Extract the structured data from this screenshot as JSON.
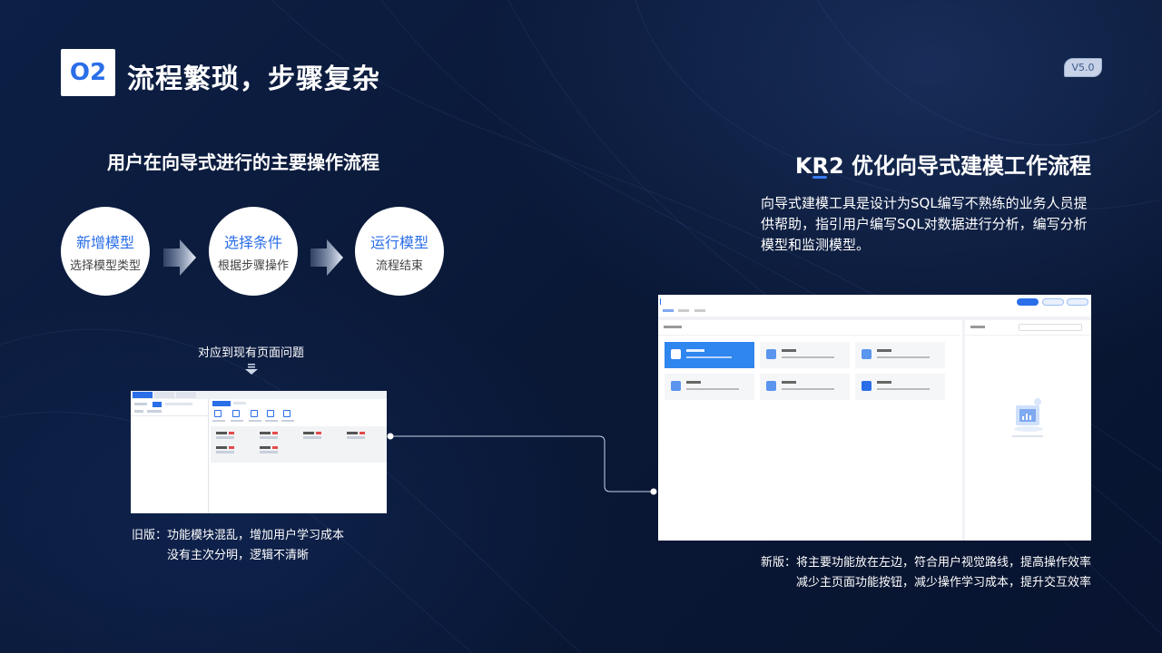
{
  "header": {
    "section_number": "O2",
    "title": "流程繁琐，步骤复杂",
    "version": "V5.0"
  },
  "left": {
    "heading": "用户在向导式进行的主要操作流程",
    "steps": [
      {
        "title": "新增模型",
        "subtitle": "选择模型类型"
      },
      {
        "title": "选择条件",
        "subtitle": "根据步骤操作"
      },
      {
        "title": "运行模型",
        "subtitle": "流程结束"
      }
    ],
    "map_label": "对应到现有页面问题",
    "old_caption_line1": "旧版：功能模块混乱，增加用户学习成本",
    "old_caption_line2": "没有主次分明，逻辑不清晰"
  },
  "right": {
    "heading": "KR2 优化向导式建模工作流程",
    "description": "向导式建模工具是设计为SQL编写不熟练的业务人员提供帮助，指引用户编写SQL对数据进行分析，编写分析模型和监测模型。",
    "new_caption_line1": "新版：将主要功能放在左边，符合用户视觉路线，提高操作效率",
    "new_caption_line2": "减少主页面功能按钮，减少操作学习成本，提升交互效率"
  },
  "colors": {
    "accent": "#2a6ee8",
    "background": "#0b1a38"
  }
}
